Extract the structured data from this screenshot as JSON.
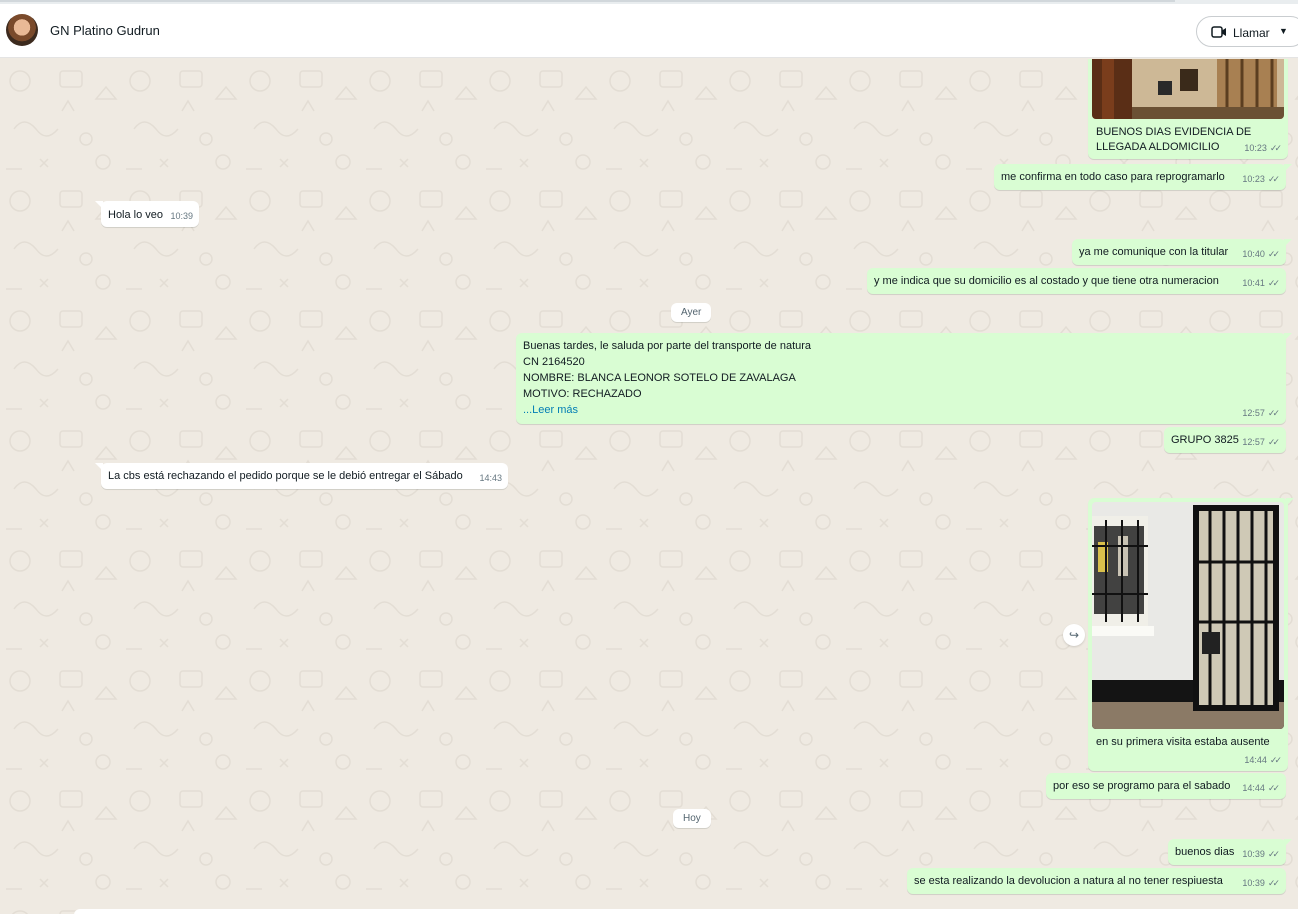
{
  "header": {
    "contact_name": "GN Platino Gudrun",
    "call_label": "Llamar",
    "avatar_icon": "contact-avatar",
    "video_icon": "video-camera-icon",
    "caret_icon": "chevron-down-icon"
  },
  "colors": {
    "outgoing_bubble": "#d9fdd3",
    "incoming_bubble": "#ffffff",
    "chat_background": "#efeae2",
    "read_more_link": "#027eb5",
    "meta_text": "#667781"
  },
  "messages": {
    "m1": {
      "direction": "out",
      "caption": "BUENOS DIAS EVIDENCIA DE",
      "caption2": "LLEGADA ALDOMICILIO",
      "time": "10:23",
      "status": "read"
    },
    "m2": {
      "direction": "out",
      "text": "me confirma en todo caso para reprogramarlo",
      "time": "10:23",
      "status": "read"
    },
    "m3": {
      "direction": "in",
      "text": "Hola lo veo",
      "time": "10:39"
    },
    "m4": {
      "direction": "out",
      "text": "ya me comunique con la titular",
      "time": "10:40",
      "status": "read"
    },
    "m5": {
      "direction": "out",
      "text": "y me indica que su domicilio es al costado y que tiene otra numeracion",
      "time": "10:41",
      "status": "read"
    },
    "m6": {
      "direction": "out",
      "line1": "Buenas tardes, le saluda por parte del transporte de natura",
      "line2": "CN 2164520",
      "line3": "NOMBRE: BLANCA LEONOR SOTELO DE ZAVALAGA",
      "line4": "MOTIVO: RECHAZADO",
      "read_more": "...Leer más",
      "time": "12:57",
      "status": "read"
    },
    "m7": {
      "direction": "out",
      "text": "GRUPO 3825",
      "time": "12:57",
      "status": "read"
    },
    "m8": {
      "direction": "in",
      "text": "La cbs está rechazando el pedido porque se le debió entregar el Sábado",
      "time": "14:43"
    },
    "m9": {
      "direction": "out",
      "caption": "en su primera visita estaba ausente",
      "time": "14:44",
      "status": "read"
    },
    "m10": {
      "direction": "out",
      "text": "por eso se programo para el sabado",
      "time": "14:44",
      "status": "read"
    },
    "m11": {
      "direction": "out",
      "text": "buenos dias",
      "time": "10:39",
      "status": "read"
    },
    "m12": {
      "direction": "out",
      "text": "se esta realizando la devolucion a natura al no tener respiuesta",
      "time": "10:39",
      "status": "read"
    }
  },
  "day_separators": {
    "yesterday": "Ayer",
    "today": "Hoy"
  },
  "icons": {
    "read_receipt": "double-check-icon",
    "forward": "forward-icon"
  }
}
